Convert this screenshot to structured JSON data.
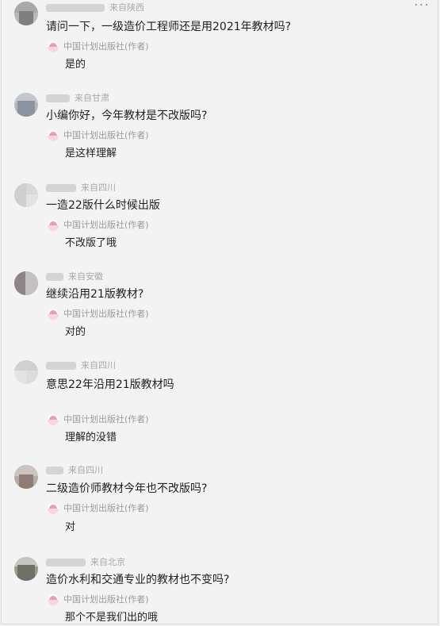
{
  "header": {
    "more_icon": "more-icon",
    "more_glyph": "···"
  },
  "author_label": "中国计划出版社(作者)",
  "comments": [
    {
      "location": "来自陕西",
      "question": "请问一下，一级造价工程师还是用2021年教材吗?",
      "answer": "是的"
    },
    {
      "location": "来自甘肃",
      "question": "小编你好，今年教材是不改版吗?",
      "answer": "是这样理解"
    },
    {
      "location": "来自四川",
      "question": "一造22版什么时候出版",
      "answer": "不改版了哦"
    },
    {
      "location": "来自安徽",
      "question": "继续沿用21版教材?",
      "answer": "对的"
    },
    {
      "location": "来自四川",
      "question": "意思22年沿用21版教材吗",
      "answer": "理解的没错"
    },
    {
      "location": "来自四川",
      "question": "二级造价师教材今年也不改版吗?",
      "answer": "对"
    },
    {
      "location": "来自北京",
      "question": "造价水利和交通专业的教材也不变吗?",
      "answer": "那个不是我们出的哦"
    }
  ]
}
